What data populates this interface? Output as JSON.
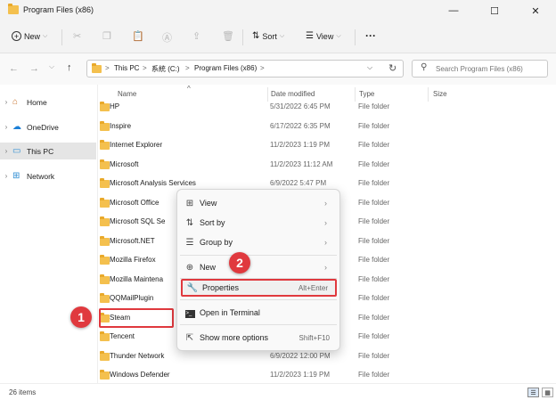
{
  "window": {
    "title": "Program Files (x86)",
    "minimize": "—",
    "maximize": "☐",
    "close": "✕"
  },
  "toolbar": {
    "new_label": "New",
    "new_caret": "⌵",
    "sort_label": "Sort",
    "view_label": "View",
    "more": "···",
    "caret": "⌵"
  },
  "address": {
    "crumbs": [
      "This PC",
      "系統 (C:)",
      "Program Files (x86)"
    ],
    "separator": ">",
    "dropdown": "⌵",
    "refresh": "↻"
  },
  "search": {
    "placeholder": "Search Program Files (x86)"
  },
  "sidebar": {
    "items": [
      {
        "label": "Home"
      },
      {
        "label": "OneDrive"
      },
      {
        "label": "This PC"
      },
      {
        "label": "Network"
      }
    ]
  },
  "columns": {
    "name": "Name",
    "date": "Date modified",
    "type": "Type",
    "size": "Size"
  },
  "files": [
    {
      "name": "HP",
      "date": "5/31/2022 6:45 PM",
      "type": "File folder"
    },
    {
      "name": "Inspire",
      "date": "6/17/2022 6:35 PM",
      "type": "File folder"
    },
    {
      "name": "Internet Explorer",
      "date": "11/2/2023 1:19 PM",
      "type": "File folder"
    },
    {
      "name": "Microsoft",
      "date": "11/2/2023 11:12 AM",
      "type": "File folder"
    },
    {
      "name": "Microsoft Analysis Services",
      "date": "6/9/2022 5:47 PM",
      "type": "File folder"
    },
    {
      "name": "Microsoft Office",
      "date": "",
      "type": "File folder"
    },
    {
      "name": "Microsoft SQL Se",
      "date": "",
      "type": "File folder"
    },
    {
      "name": "Microsoft.NET",
      "date": "",
      "type": "File folder"
    },
    {
      "name": "Mozilla Firefox",
      "date": "",
      "type": "File folder"
    },
    {
      "name": "Mozilla Maintena",
      "date": "",
      "type": "File folder"
    },
    {
      "name": "QQMailPlugin",
      "date": "",
      "type": "File folder"
    },
    {
      "name": "Steam",
      "date": "",
      "type": "File folder"
    },
    {
      "name": "Tencent",
      "date": "",
      "type": "File folder"
    },
    {
      "name": "Thunder Network",
      "date": "6/9/2022 12:00 PM",
      "type": "File folder"
    },
    {
      "name": "Windows Defender",
      "date": "11/2/2023 1:19 PM",
      "type": "File folder"
    }
  ],
  "context_menu": {
    "view": "View",
    "sort_by": "Sort by",
    "group_by": "Group by",
    "new": "New",
    "properties": "Properties",
    "properties_shortcut": "Alt+Enter",
    "open_terminal": "Open in Terminal",
    "show_more": "Show more options",
    "show_more_shortcut": "Shift+F10"
  },
  "callouts": {
    "one": "1",
    "two": "2"
  },
  "status": {
    "items_count": "26 items"
  },
  "colors": {
    "accent_red": "#e0393e",
    "folder": "#f4c04e",
    "selection": "#e5e5e5"
  }
}
